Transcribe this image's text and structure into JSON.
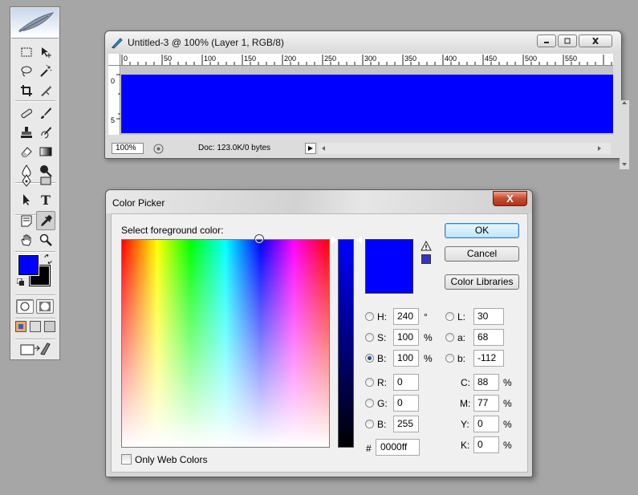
{
  "document": {
    "title": "Untitled-3 @ 100% (Layer 1, RGB/8)",
    "ruler_ticks": [
      "0",
      "50",
      "100",
      "150",
      "200",
      "250",
      "300",
      "350",
      "400",
      "450",
      "500",
      "550"
    ],
    "left_ruler_ticks": [
      "0",
      "5"
    ],
    "zoom": "100%",
    "doc_info": "Doc: 123.0K/0 bytes",
    "canvas_color": "#0000ff"
  },
  "picker": {
    "title": "Color Picker",
    "close_symbol": "X",
    "prompt": "Select foreground color:",
    "ok_label": "OK",
    "cancel_label": "Cancel",
    "libraries_label": "Color Libraries",
    "current_color": "#0000ff",
    "hsb": [
      {
        "label": "H:",
        "value": "240",
        "unit": "°",
        "selected": false
      },
      {
        "label": "S:",
        "value": "100",
        "unit": "%",
        "selected": false
      },
      {
        "label": "B:",
        "value": "100",
        "unit": "%",
        "selected": true
      }
    ],
    "rgb": [
      {
        "label": "R:",
        "value": "0"
      },
      {
        "label": "G:",
        "value": "0"
      },
      {
        "label": "B:",
        "value": "255"
      }
    ],
    "lab": [
      {
        "label": "L:",
        "value": "30"
      },
      {
        "label": "a:",
        "value": "68"
      },
      {
        "label": "b:",
        "value": "-112"
      }
    ],
    "cmyk": [
      {
        "label": "C:",
        "value": "88",
        "unit": "%"
      },
      {
        "label": "M:",
        "value": "77",
        "unit": "%"
      },
      {
        "label": "Y:",
        "value": "0",
        "unit": "%"
      },
      {
        "label": "K:",
        "value": "0",
        "unit": "%"
      }
    ],
    "hex_prefix": "#",
    "hex_value": "0000ff",
    "web_colors_label": "Only Web Colors"
  },
  "toolbox": {
    "foreground_color": "#0000ff",
    "background_color": "#000000"
  }
}
